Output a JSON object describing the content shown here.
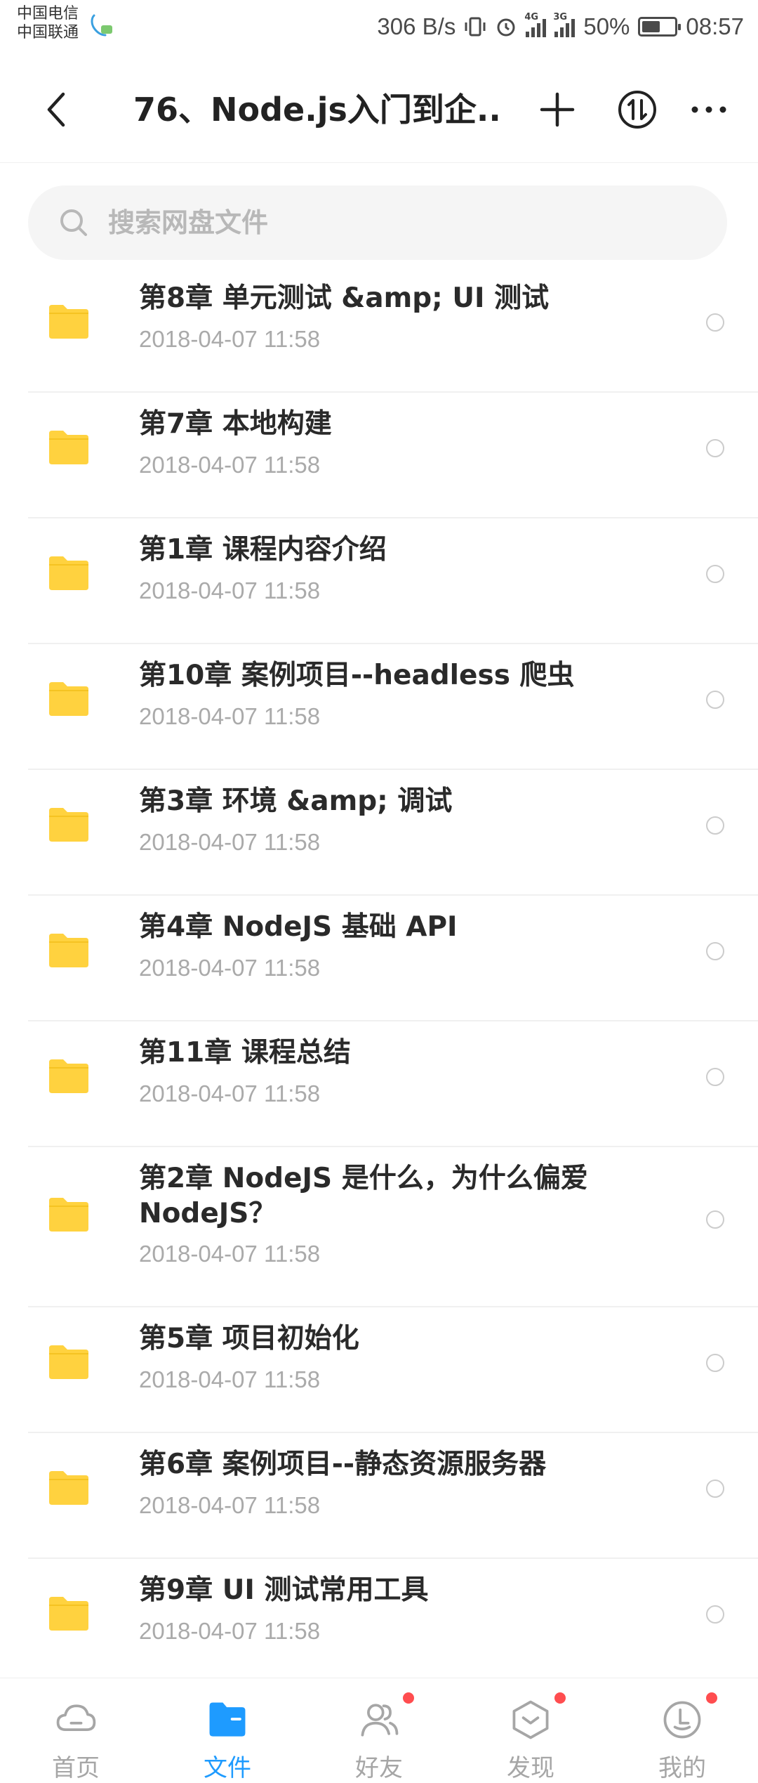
{
  "status_bar": {
    "carrier_1": "中国电信",
    "carrier_2": "中国联通",
    "speed": "306 B/s",
    "network_1": "4G",
    "network_2": "3G",
    "battery_pct": "50%",
    "battery_level": 0.5,
    "time": "08:57"
  },
  "nav": {
    "title": "76、Node.js入门到企..."
  },
  "search": {
    "placeholder": "搜索网盘文件"
  },
  "colors": {
    "folder": "#FFD23F",
    "accent": "#1E9BFF",
    "badge": "#FF4D4F"
  },
  "files": [
    {
      "name": "第8章 单元测试 &amp; UI 测试",
      "date": "2018-04-07  11:58"
    },
    {
      "name": "第7章 本地构建",
      "date": "2018-04-07  11:58"
    },
    {
      "name": "第1章 课程内容介绍",
      "date": "2018-04-07  11:58"
    },
    {
      "name": "第10章 案例项目--headless 爬虫",
      "date": "2018-04-07  11:58"
    },
    {
      "name": "第3章 环境 &amp; 调试",
      "date": "2018-04-07  11:58"
    },
    {
      "name": "第4章 NodeJS 基础 API",
      "date": "2018-04-07  11:58"
    },
    {
      "name": "第11章 课程总结",
      "date": "2018-04-07  11:58"
    },
    {
      "name": "第2章 NodeJS 是什么，为什么偏爱NodeJS？",
      "date": "2018-04-07  11:58"
    },
    {
      "name": "第5章 项目初始化",
      "date": "2018-04-07  11:58"
    },
    {
      "name": "第6章 案例项目--静态资源服务器",
      "date": "2018-04-07  11:58"
    },
    {
      "name": "第9章 UI 测试常用工具",
      "date": "2018-04-07  11:58"
    }
  ],
  "tabs": [
    {
      "label": "首页",
      "icon": "cloud-icon",
      "active": false,
      "badge": false
    },
    {
      "label": "文件",
      "icon": "folder-icon",
      "active": true,
      "badge": false
    },
    {
      "label": "好友",
      "icon": "friends-icon",
      "active": false,
      "badge": true
    },
    {
      "label": "发现",
      "icon": "discover-icon",
      "active": false,
      "badge": true
    },
    {
      "label": "我的",
      "icon": "profile-icon",
      "active": false,
      "badge": true
    }
  ]
}
